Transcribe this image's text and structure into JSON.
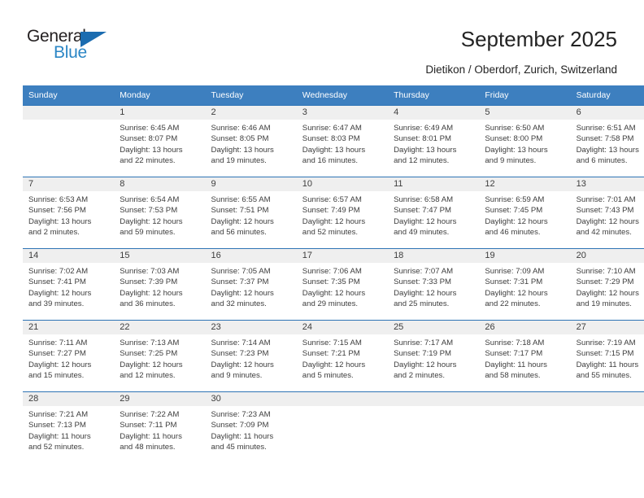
{
  "brand": {
    "name_part1": "General",
    "name_part2": "Blue",
    "triangle_color": "#1b6cb0",
    "blue_color": "#2b86c5",
    "dark_color": "#231f20"
  },
  "header": {
    "title": "September 2025",
    "subtitle": "Dietikon / Oberdorf, Zurich, Switzerland"
  },
  "theme": {
    "header_blue": "#3d7fbf",
    "rule_blue": "#2e74b5",
    "daynum_band": "#efefef",
    "text": "#3d3d3d"
  },
  "calendar": {
    "weekday_headers": [
      "Sunday",
      "Monday",
      "Tuesday",
      "Wednesday",
      "Thursday",
      "Friday",
      "Saturday"
    ],
    "weeks": [
      [
        {
          "day": "",
          "sunrise": "",
          "sunset": "",
          "daylight1": "",
          "daylight2": ""
        },
        {
          "day": "1",
          "sunrise": "Sunrise: 6:45 AM",
          "sunset": "Sunset: 8:07 PM",
          "daylight1": "Daylight: 13 hours",
          "daylight2": "and 22 minutes."
        },
        {
          "day": "2",
          "sunrise": "Sunrise: 6:46 AM",
          "sunset": "Sunset: 8:05 PM",
          "daylight1": "Daylight: 13 hours",
          "daylight2": "and 19 minutes."
        },
        {
          "day": "3",
          "sunrise": "Sunrise: 6:47 AM",
          "sunset": "Sunset: 8:03 PM",
          "daylight1": "Daylight: 13 hours",
          "daylight2": "and 16 minutes."
        },
        {
          "day": "4",
          "sunrise": "Sunrise: 6:49 AM",
          "sunset": "Sunset: 8:01 PM",
          "daylight1": "Daylight: 13 hours",
          "daylight2": "and 12 minutes."
        },
        {
          "day": "5",
          "sunrise": "Sunrise: 6:50 AM",
          "sunset": "Sunset: 8:00 PM",
          "daylight1": "Daylight: 13 hours",
          "daylight2": "and 9 minutes."
        },
        {
          "day": "6",
          "sunrise": "Sunrise: 6:51 AM",
          "sunset": "Sunset: 7:58 PM",
          "daylight1": "Daylight: 13 hours",
          "daylight2": "and 6 minutes."
        }
      ],
      [
        {
          "day": "7",
          "sunrise": "Sunrise: 6:53 AM",
          "sunset": "Sunset: 7:56 PM",
          "daylight1": "Daylight: 13 hours",
          "daylight2": "and 2 minutes."
        },
        {
          "day": "8",
          "sunrise": "Sunrise: 6:54 AM",
          "sunset": "Sunset: 7:53 PM",
          "daylight1": "Daylight: 12 hours",
          "daylight2": "and 59 minutes."
        },
        {
          "day": "9",
          "sunrise": "Sunrise: 6:55 AM",
          "sunset": "Sunset: 7:51 PM",
          "daylight1": "Daylight: 12 hours",
          "daylight2": "and 56 minutes."
        },
        {
          "day": "10",
          "sunrise": "Sunrise: 6:57 AM",
          "sunset": "Sunset: 7:49 PM",
          "daylight1": "Daylight: 12 hours",
          "daylight2": "and 52 minutes."
        },
        {
          "day": "11",
          "sunrise": "Sunrise: 6:58 AM",
          "sunset": "Sunset: 7:47 PM",
          "daylight1": "Daylight: 12 hours",
          "daylight2": "and 49 minutes."
        },
        {
          "day": "12",
          "sunrise": "Sunrise: 6:59 AM",
          "sunset": "Sunset: 7:45 PM",
          "daylight1": "Daylight: 12 hours",
          "daylight2": "and 46 minutes."
        },
        {
          "day": "13",
          "sunrise": "Sunrise: 7:01 AM",
          "sunset": "Sunset: 7:43 PM",
          "daylight1": "Daylight: 12 hours",
          "daylight2": "and 42 minutes."
        }
      ],
      [
        {
          "day": "14",
          "sunrise": "Sunrise: 7:02 AM",
          "sunset": "Sunset: 7:41 PM",
          "daylight1": "Daylight: 12 hours",
          "daylight2": "and 39 minutes."
        },
        {
          "day": "15",
          "sunrise": "Sunrise: 7:03 AM",
          "sunset": "Sunset: 7:39 PM",
          "daylight1": "Daylight: 12 hours",
          "daylight2": "and 36 minutes."
        },
        {
          "day": "16",
          "sunrise": "Sunrise: 7:05 AM",
          "sunset": "Sunset: 7:37 PM",
          "daylight1": "Daylight: 12 hours",
          "daylight2": "and 32 minutes."
        },
        {
          "day": "17",
          "sunrise": "Sunrise: 7:06 AM",
          "sunset": "Sunset: 7:35 PM",
          "daylight1": "Daylight: 12 hours",
          "daylight2": "and 29 minutes."
        },
        {
          "day": "18",
          "sunrise": "Sunrise: 7:07 AM",
          "sunset": "Sunset: 7:33 PM",
          "daylight1": "Daylight: 12 hours",
          "daylight2": "and 25 minutes."
        },
        {
          "day": "19",
          "sunrise": "Sunrise: 7:09 AM",
          "sunset": "Sunset: 7:31 PM",
          "daylight1": "Daylight: 12 hours",
          "daylight2": "and 22 minutes."
        },
        {
          "day": "20",
          "sunrise": "Sunrise: 7:10 AM",
          "sunset": "Sunset: 7:29 PM",
          "daylight1": "Daylight: 12 hours",
          "daylight2": "and 19 minutes."
        }
      ],
      [
        {
          "day": "21",
          "sunrise": "Sunrise: 7:11 AM",
          "sunset": "Sunset: 7:27 PM",
          "daylight1": "Daylight: 12 hours",
          "daylight2": "and 15 minutes."
        },
        {
          "day": "22",
          "sunrise": "Sunrise: 7:13 AM",
          "sunset": "Sunset: 7:25 PM",
          "daylight1": "Daylight: 12 hours",
          "daylight2": "and 12 minutes."
        },
        {
          "day": "23",
          "sunrise": "Sunrise: 7:14 AM",
          "sunset": "Sunset: 7:23 PM",
          "daylight1": "Daylight: 12 hours",
          "daylight2": "and 9 minutes."
        },
        {
          "day": "24",
          "sunrise": "Sunrise: 7:15 AM",
          "sunset": "Sunset: 7:21 PM",
          "daylight1": "Daylight: 12 hours",
          "daylight2": "and 5 minutes."
        },
        {
          "day": "25",
          "sunrise": "Sunrise: 7:17 AM",
          "sunset": "Sunset: 7:19 PM",
          "daylight1": "Daylight: 12 hours",
          "daylight2": "and 2 minutes."
        },
        {
          "day": "26",
          "sunrise": "Sunrise: 7:18 AM",
          "sunset": "Sunset: 7:17 PM",
          "daylight1": "Daylight: 11 hours",
          "daylight2": "and 58 minutes."
        },
        {
          "day": "27",
          "sunrise": "Sunrise: 7:19 AM",
          "sunset": "Sunset: 7:15 PM",
          "daylight1": "Daylight: 11 hours",
          "daylight2": "and 55 minutes."
        }
      ],
      [
        {
          "day": "28",
          "sunrise": "Sunrise: 7:21 AM",
          "sunset": "Sunset: 7:13 PM",
          "daylight1": "Daylight: 11 hours",
          "daylight2": "and 52 minutes."
        },
        {
          "day": "29",
          "sunrise": "Sunrise: 7:22 AM",
          "sunset": "Sunset: 7:11 PM",
          "daylight1": "Daylight: 11 hours",
          "daylight2": "and 48 minutes."
        },
        {
          "day": "30",
          "sunrise": "Sunrise: 7:23 AM",
          "sunset": "Sunset: 7:09 PM",
          "daylight1": "Daylight: 11 hours",
          "daylight2": "and 45 minutes."
        },
        {
          "day": "",
          "sunrise": "",
          "sunset": "",
          "daylight1": "",
          "daylight2": ""
        },
        {
          "day": "",
          "sunrise": "",
          "sunset": "",
          "daylight1": "",
          "daylight2": ""
        },
        {
          "day": "",
          "sunrise": "",
          "sunset": "",
          "daylight1": "",
          "daylight2": ""
        },
        {
          "day": "",
          "sunrise": "",
          "sunset": "",
          "daylight1": "",
          "daylight2": ""
        }
      ]
    ]
  }
}
